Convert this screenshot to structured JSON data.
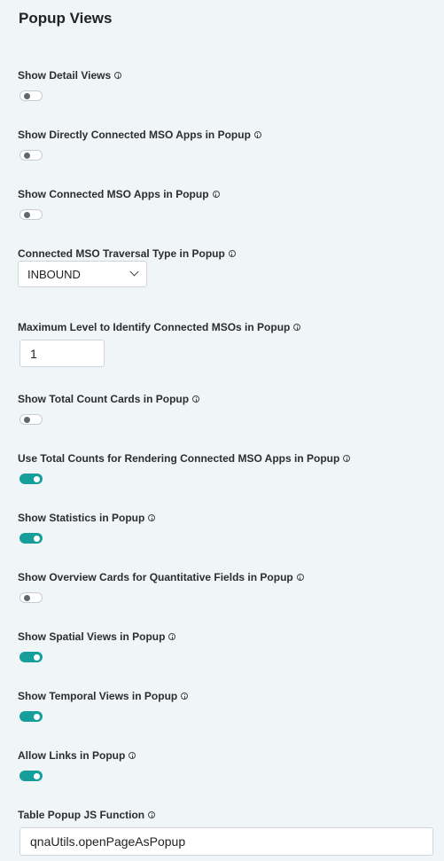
{
  "page": {
    "title": "Popup Views"
  },
  "fields": {
    "show_detail_views": {
      "label": "Show Detail Views",
      "enabled": false
    },
    "show_directly_connected": {
      "label": "Show Directly Connected MSO Apps in Popup",
      "enabled": false
    },
    "show_connected": {
      "label": "Show Connected MSO Apps in Popup",
      "enabled": false
    },
    "traversal_type": {
      "label": "Connected MSO Traversal Type in Popup",
      "value": "INBOUND"
    },
    "max_level": {
      "label": "Maximum Level to Identify Connected MSOs in Popup",
      "value": "1"
    },
    "total_count_cards": {
      "label": "Show Total Count Cards in Popup",
      "enabled": false
    },
    "use_total_counts": {
      "label": "Use Total Counts for Rendering Connected MSO Apps in Popup",
      "enabled": true
    },
    "show_statistics": {
      "label": "Show Statistics in Popup",
      "enabled": true
    },
    "overview_cards": {
      "label": "Show Overview Cards for Quantitative Fields in Popup",
      "enabled": false
    },
    "spatial_views": {
      "label": "Show Spatial Views in Popup",
      "enabled": true
    },
    "temporal_views": {
      "label": "Show Temporal Views in Popup",
      "enabled": true
    },
    "allow_links": {
      "label": "Allow Links in Popup",
      "enabled": true
    },
    "table_popup_fn": {
      "label": "Table Popup JS Function",
      "value": "qnaUtils.openPageAsPopup"
    }
  }
}
